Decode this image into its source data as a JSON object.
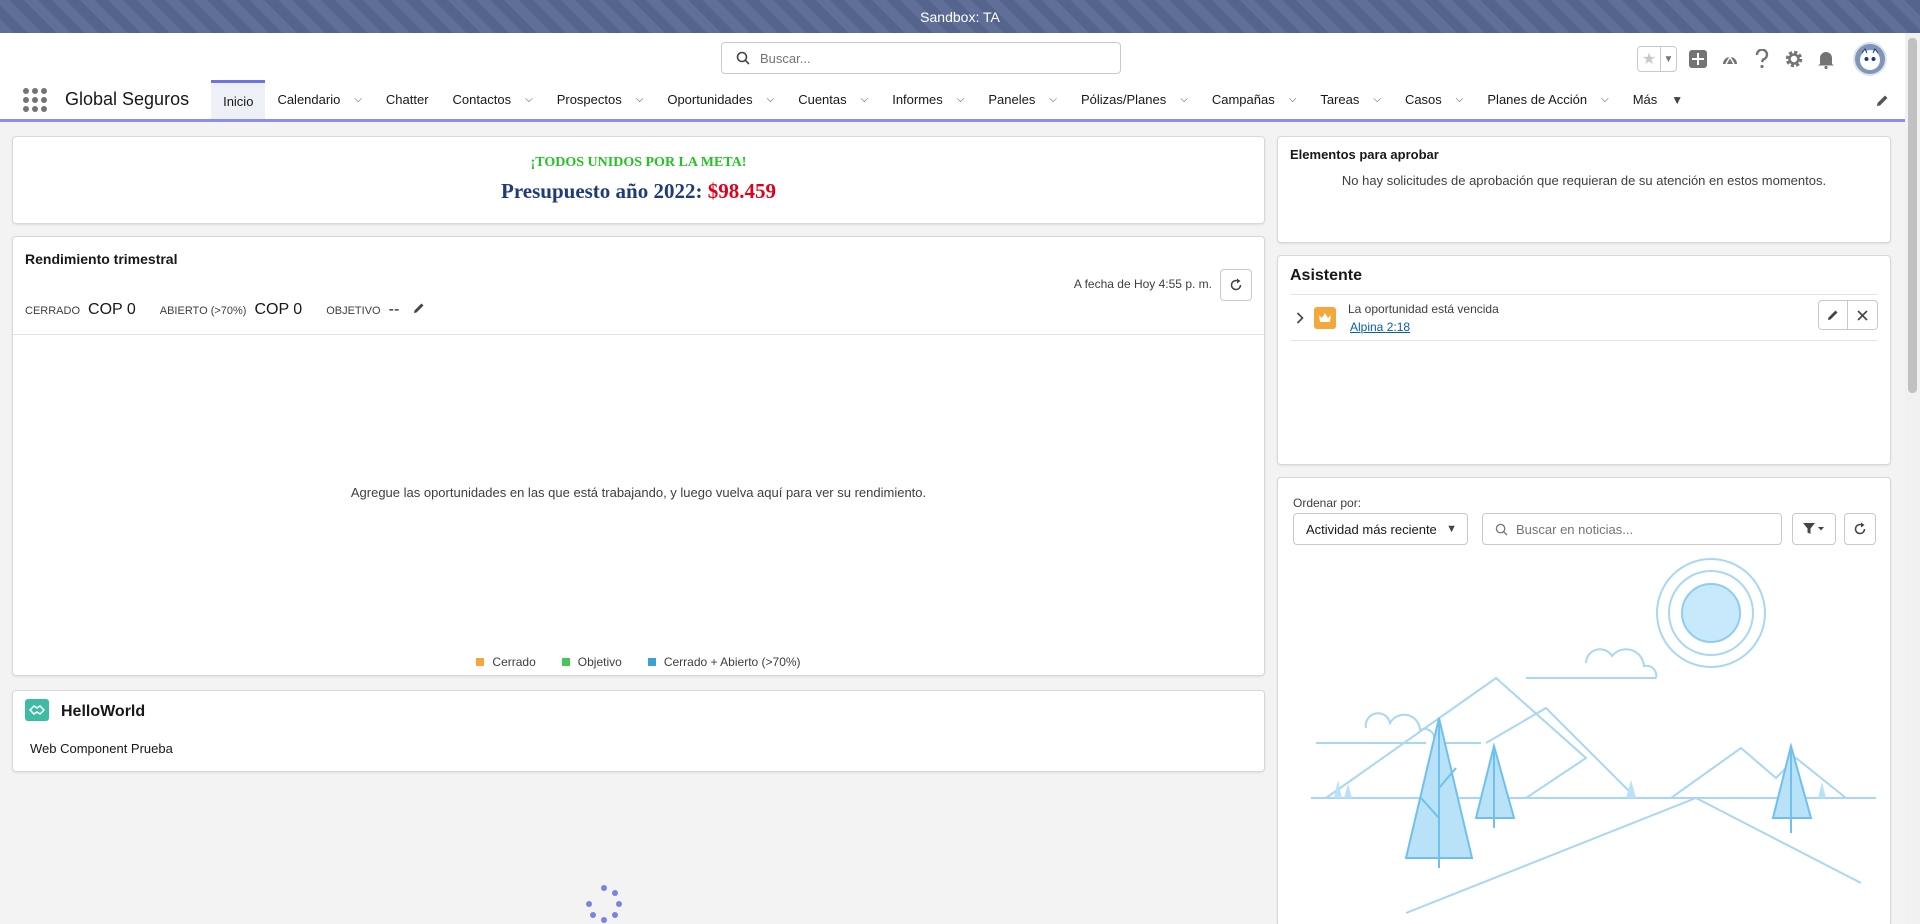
{
  "sandbox_label": "Sandbox: TA",
  "header": {
    "search_placeholder": "Buscar..."
  },
  "nav": {
    "app_name": "Global Seguros",
    "items": [
      {
        "label": "Inicio"
      },
      {
        "label": "Calendario"
      },
      {
        "label": "Chatter"
      },
      {
        "label": "Contactos"
      },
      {
        "label": "Prospectos"
      },
      {
        "label": "Oportunidades"
      },
      {
        "label": "Cuentas"
      },
      {
        "label": "Informes"
      },
      {
        "label": "Paneles"
      },
      {
        "label": "Pólizas/Planes"
      },
      {
        "label": "Campañas"
      },
      {
        "label": "Tareas"
      },
      {
        "label": "Casos"
      },
      {
        "label": "Planes de Acción"
      },
      {
        "label": "Más"
      }
    ]
  },
  "banner": {
    "slogan": "¡TODOS UNIDOS POR LA META!",
    "budget_label": "Presupuesto año 2022: ",
    "budget_amount": "$98.459"
  },
  "performance": {
    "title": "Rendimiento trimestral",
    "as_of": "A fecha de Hoy 4:55 p. m.",
    "closed_label": "CERRADO",
    "closed_value": "COP 0",
    "open_label": "ABIERTO (>70%)",
    "open_value": "COP 0",
    "goal_label": "OBJETIVO",
    "goal_value": "--",
    "empty_message": "Agregue las oportunidades en las que está trabajando, y luego vuelva aquí para ver su rendimiento.",
    "legend": [
      {
        "label": "Cerrado",
        "color": "#f4a73a"
      },
      {
        "label": "Objetivo",
        "color": "#45c65a"
      },
      {
        "label": "Cerrado + Abierto (>70%)",
        "color": "#3ba0d4"
      }
    ]
  },
  "hello": {
    "title": "HelloWorld",
    "description": "Web Component Prueba"
  },
  "approvals": {
    "title": "Elementos para aprobar",
    "message": "No hay solicitudes de aprobación que requieran de su atención en estos momentos."
  },
  "assistant": {
    "title": "Asistente",
    "item_text": "La oportunidad está vencida",
    "item_link": "Alpina 2:18"
  },
  "feed": {
    "sort_label": "Ordenar por:",
    "sort_value": "Actividad más reciente",
    "search_placeholder": "Buscar en noticias..."
  }
}
